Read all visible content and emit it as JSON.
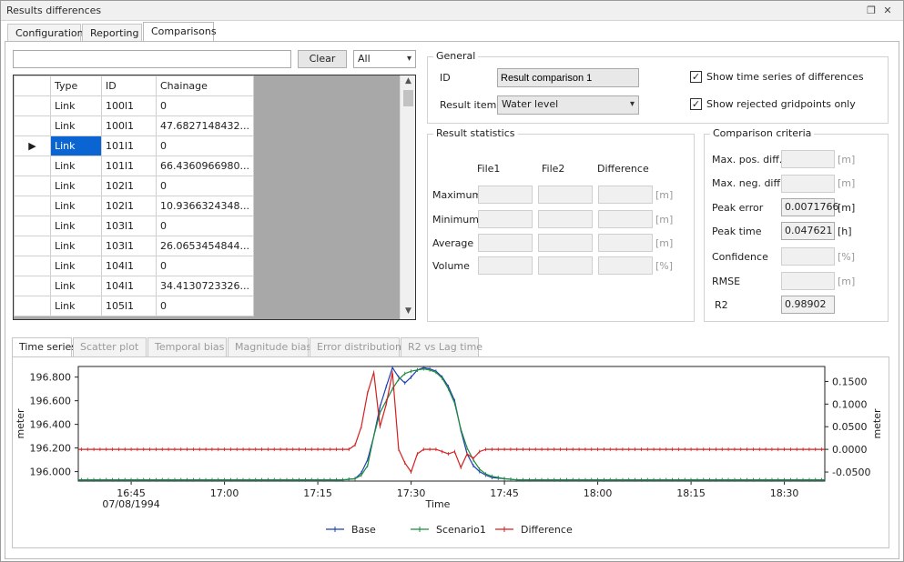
{
  "window": {
    "title": "Results differences",
    "restore_glyph": "❐",
    "close_glyph": "✕"
  },
  "tabs": [
    {
      "label": "Configuration"
    },
    {
      "label": "Reporting"
    },
    {
      "label": "Comparisons"
    }
  ],
  "filter": {
    "search_value": "",
    "clear_label": "Clear",
    "select_value": "All"
  },
  "grid": {
    "columns": [
      "Type",
      "ID",
      "Chainage"
    ],
    "rows": [
      {
        "type": "Link",
        "id": "100l1",
        "chainage": "0"
      },
      {
        "type": "Link",
        "id": "100l1",
        "chainage": "47.6827148432..."
      },
      {
        "type": "Link",
        "id": "101l1",
        "chainage": "0"
      },
      {
        "type": "Link",
        "id": "101l1",
        "chainage": "66.4360966980..."
      },
      {
        "type": "Link",
        "id": "102l1",
        "chainage": "0"
      },
      {
        "type": "Link",
        "id": "102l1",
        "chainage": "10.9366324348..."
      },
      {
        "type": "Link",
        "id": "103l1",
        "chainage": "0"
      },
      {
        "type": "Link",
        "id": "103l1",
        "chainage": "26.0653454844..."
      },
      {
        "type": "Link",
        "id": "104l1",
        "chainage": "0"
      },
      {
        "type": "Link",
        "id": "104l1",
        "chainage": "34.4130723326..."
      },
      {
        "type": "Link",
        "id": "105l1",
        "chainage": "0"
      }
    ],
    "selected_row_marker": "▶"
  },
  "general": {
    "legend": "General",
    "id_label": "ID",
    "id_value": "Result comparison 1",
    "result_item_label": "Result item",
    "result_item_value": "Water level",
    "show_ts_label": "Show time series of differences",
    "show_rejected_label": "Show rejected gridpoints only",
    "check_glyph": "✓"
  },
  "stats": {
    "legend": "Result statistics",
    "headers": [
      "File1",
      "File2",
      "Difference"
    ],
    "rows": [
      {
        "label": "Maximum",
        "unit": "[m]"
      },
      {
        "label": "Minimum",
        "unit": "[m]"
      },
      {
        "label": "Average",
        "unit": "[m]"
      },
      {
        "label": "Volume",
        "unit": "[%]"
      }
    ]
  },
  "criteria": {
    "legend": "Comparison criteria",
    "rows": [
      {
        "label": "Max. pos. diff.",
        "value": "",
        "unit": "[m]",
        "enabled": false
      },
      {
        "label": "Max. neg. diff.",
        "value": "",
        "unit": "[m]",
        "enabled": false
      },
      {
        "label": "Peak error",
        "value": "0.0071766",
        "unit": "[m]",
        "enabled": true
      },
      {
        "label": "Peak time",
        "value": "0.047621",
        "unit": "[h]",
        "enabled": true
      },
      {
        "label": "Confidence",
        "value": "",
        "unit": "[%]",
        "enabled": false
      },
      {
        "label": "RMSE",
        "value": "",
        "unit": "[m]",
        "enabled": false
      },
      {
        "label": "R2",
        "value": "0.98902",
        "unit": "",
        "enabled": true
      }
    ]
  },
  "chart_tabs": [
    {
      "label": "Time series"
    },
    {
      "label": "Scatter plot"
    },
    {
      "label": "Temporal bias"
    },
    {
      "label": "Magnitude bias"
    },
    {
      "label": "Error distribution"
    },
    {
      "label": "R2 vs Lag time"
    }
  ],
  "chart_data": {
    "type": "line",
    "title": "",
    "xlabel": "Time",
    "ylabel": "meter",
    "y2label": "meter",
    "x_ticks": [
      "16:45",
      "17:00",
      "17:15",
      "17:30",
      "17:45",
      "18:00",
      "18:15",
      "18:30"
    ],
    "x_tick_minutes": [
      0,
      15,
      30,
      45,
      60,
      75,
      90,
      105
    ],
    "x_sub_label": "07/08/1994",
    "xlim_minutes": [
      -8.5,
      111.5
    ],
    "ylim": [
      195.92,
      196.89
    ],
    "y_ticks": [
      "196.000",
      "196.200",
      "196.400",
      "196.600",
      "196.800"
    ],
    "y_tick_values": [
      196.0,
      196.2,
      196.4,
      196.6,
      196.8
    ],
    "y2lim": [
      -0.07,
      0.183
    ],
    "y2_ticks": [
      "-0.0500",
      "0.0000",
      "0.0500",
      "0.1000",
      "0.1500"
    ],
    "y2_tick_values": [
      -0.05,
      0.0,
      0.05,
      0.1,
      0.15
    ],
    "legend_position": "bottom",
    "series": [
      {
        "name": "Base",
        "color": "#1f3fb4",
        "axis": "left",
        "x": [
          -8.5,
          34,
          36,
          37,
          38,
          39,
          40,
          41,
          42,
          43,
          44,
          45,
          46,
          47,
          48,
          49,
          50,
          51,
          52,
          53,
          54,
          55,
          56,
          57,
          58,
          60,
          62,
          66,
          111.5
        ],
        "y": [
          195.93,
          195.93,
          195.94,
          195.99,
          196.1,
          196.3,
          196.55,
          196.72,
          196.88,
          196.8,
          196.75,
          196.8,
          196.86,
          196.88,
          196.87,
          196.85,
          196.8,
          196.72,
          196.6,
          196.35,
          196.15,
          196.05,
          196.0,
          195.97,
          195.95,
          195.94,
          195.93,
          195.93,
          195.93
        ]
      },
      {
        "name": "Scenario1",
        "color": "#1c8c3c",
        "axis": "left",
        "x": [
          -8.5,
          34,
          36,
          37,
          38,
          39,
          40,
          41,
          42,
          43,
          44,
          45,
          46,
          47,
          48,
          49,
          50,
          51,
          52,
          53,
          54,
          55,
          56,
          57,
          58,
          60,
          62,
          66,
          111.5
        ],
        "y": [
          195.93,
          195.93,
          195.94,
          195.97,
          196.05,
          196.3,
          196.5,
          196.6,
          196.7,
          196.78,
          196.83,
          196.85,
          196.86,
          196.87,
          196.86,
          196.84,
          196.79,
          196.7,
          196.58,
          196.36,
          196.2,
          196.1,
          196.02,
          195.98,
          195.96,
          195.94,
          195.93,
          195.93,
          195.93
        ]
      },
      {
        "name": "Difference",
        "color": "#d42020",
        "axis": "right",
        "x": [
          -8.5,
          34,
          35,
          36,
          37,
          38,
          39,
          40,
          41,
          42,
          43,
          44,
          45,
          46,
          47,
          48,
          49,
          50,
          51,
          52,
          53,
          54,
          55,
          56,
          57,
          60,
          111.5
        ],
        "y": [
          0.0,
          0.0,
          0.0,
          0.01,
          0.05,
          0.125,
          0.17,
          0.05,
          0.1,
          0.17,
          0.0,
          -0.03,
          -0.05,
          -0.01,
          0.0,
          0.0,
          0.0,
          -0.005,
          -0.01,
          -0.005,
          -0.04,
          -0.01,
          -0.02,
          -0.005,
          0.0,
          0.0,
          0.0
        ]
      }
    ]
  }
}
